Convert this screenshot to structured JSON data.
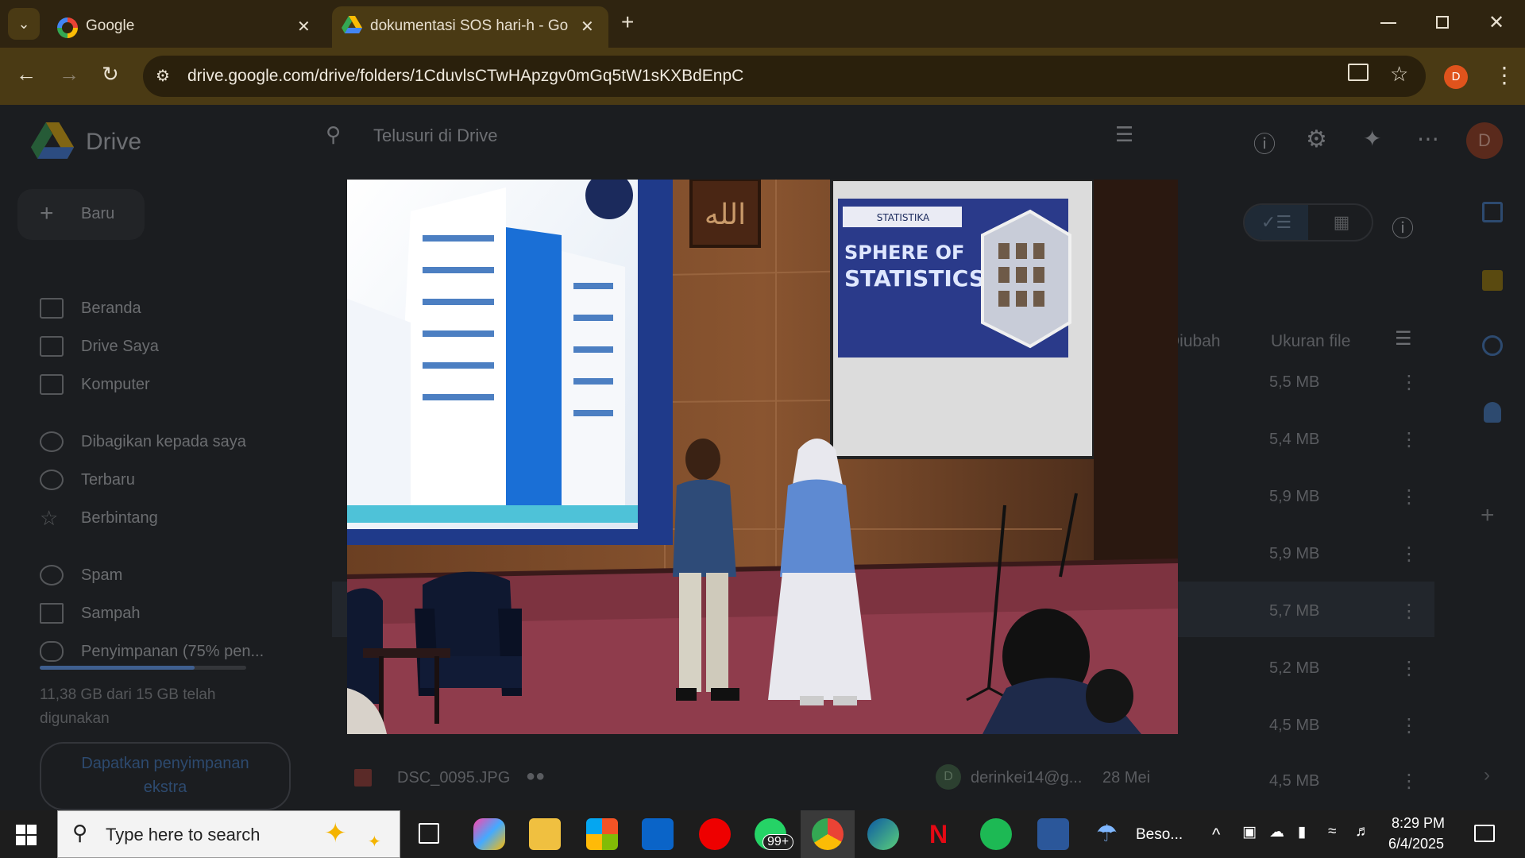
{
  "browser": {
    "tabs": [
      {
        "title": "Google",
        "icon": "google-icon",
        "active": false
      },
      {
        "title": "dokumentasi SOS hari-h - Goog",
        "icon": "drive-icon",
        "active": true
      }
    ],
    "url": "drive.google.com/drive/folders/1CduvlsCTwHApzgv0mGq5tW1sKXBdEnpC",
    "profile_initial": "D"
  },
  "drive": {
    "logo_text": "Drive",
    "search_placeholder": "Telusuri di Drive",
    "new_button": "Baru",
    "avatar_initial": "D",
    "sidebar": [
      {
        "label": "Beranda",
        "icon": "home-icon"
      },
      {
        "label": "Drive Saya",
        "icon": "my-drive-icon"
      },
      {
        "label": "Komputer",
        "icon": "computer-icon"
      },
      {
        "label": "Dibagikan kepada saya",
        "icon": "shared-icon"
      },
      {
        "label": "Terbaru",
        "icon": "clock-icon"
      },
      {
        "label": "Berbintang",
        "icon": "star-icon"
      },
      {
        "label": "Spam",
        "icon": "spam-icon"
      },
      {
        "label": "Sampah",
        "icon": "trash-icon"
      },
      {
        "label": "Penyimpanan (75% pen...",
        "icon": "cloud-icon"
      }
    ],
    "storage_text": "11,38 GB dari 15 GB telah digunakan",
    "storage_percent": 75,
    "get_storage_button": "Dapatkan penyimpanan ekstra",
    "col_modified": "Diubah",
    "col_size": "Ukuran file",
    "sizes": [
      "5,5 MB",
      "5,4 MB",
      "5,9 MB",
      "5,9 MB",
      "5,7 MB",
      "5,2 MB",
      "4,5 MB",
      "4,5 MB"
    ],
    "last_row": {
      "name": "DSC_0095.JPG",
      "owner": "derinkei14@g...",
      "modified": "28 Mei"
    }
  },
  "photo": {
    "screen_title_1": "SPHERE OF",
    "screen_title_2": "STATISTICS",
    "screen_badge": "STATISTIKA"
  },
  "taskbar": {
    "search_placeholder": "Type here to search",
    "whatsapp_badge": "99+",
    "weather_text": "Beso...",
    "time": "8:29 PM",
    "date": "6/4/2025"
  }
}
